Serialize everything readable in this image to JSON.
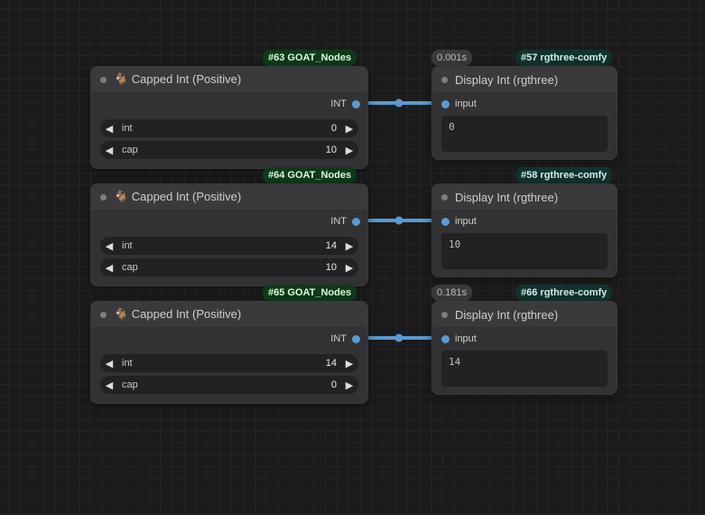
{
  "tags": {
    "n63": "#63 GOAT_Nodes",
    "n64": "#64 GOAT_Nodes",
    "n65": "#65 GOAT_Nodes",
    "n57": "#57 rgthree-comfy",
    "n58": "#58 rgthree-comfy",
    "n66": "#66 rgthree-comfy",
    "t57": "0.001s",
    "t66": "0.181s"
  },
  "cappedTitle": "🐐 Capped Int (Positive)",
  "outLabel": "INT",
  "wLabels": {
    "int": "int",
    "cap": "cap"
  },
  "dispTitle": "Display Int (rgthree)",
  "inLabel": "input",
  "nodes": {
    "c63": {
      "int": "0",
      "cap": "10"
    },
    "c64": {
      "int": "14",
      "cap": "10"
    },
    "c65": {
      "int": "14",
      "cap": "0"
    }
  },
  "disp": {
    "d57": "0",
    "d58": "10",
    "d66": "14"
  }
}
